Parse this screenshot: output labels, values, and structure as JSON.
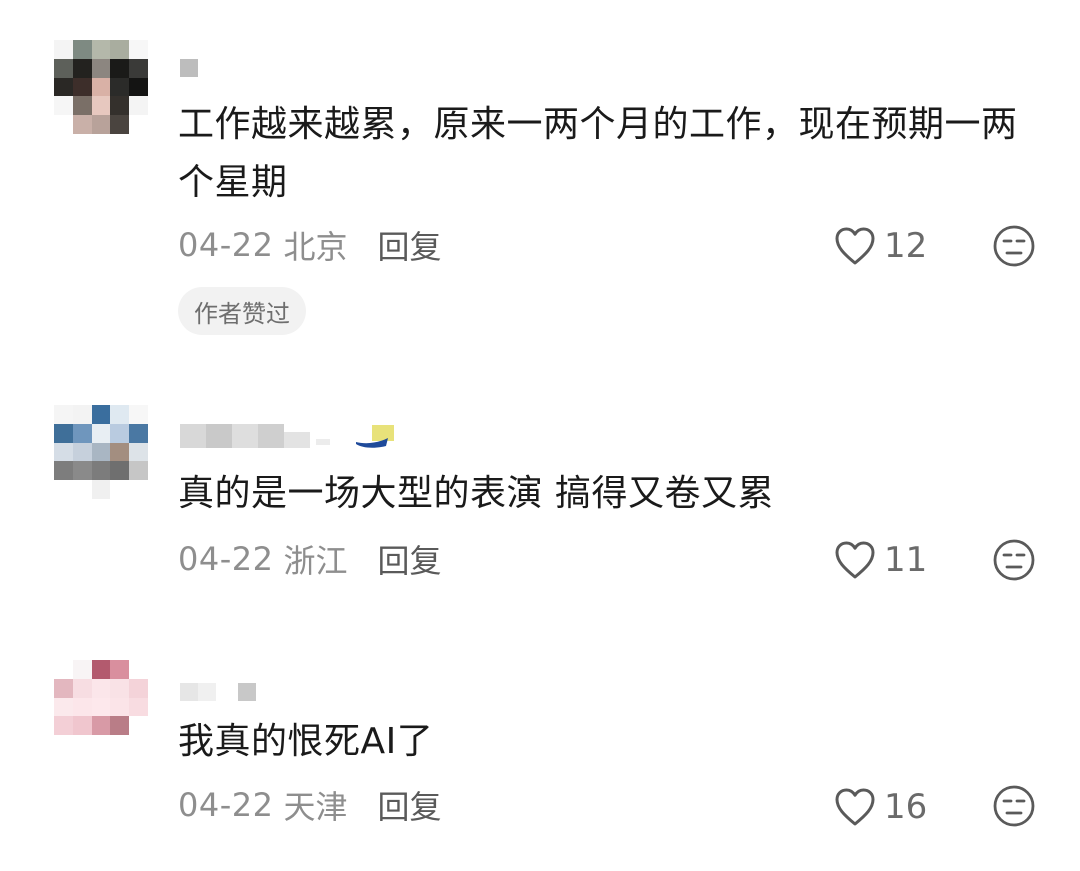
{
  "comments": [
    {
      "text": "工作越来越累，原来一两个月的工作，现在预期一两个星期",
      "date": "04-22",
      "location": "北京",
      "reply_label": "回复",
      "likes": "12",
      "badge": "作者赞过"
    },
    {
      "text": "真的是一场大型的表演 搞得又卷又累",
      "date": "04-22",
      "location": "浙江",
      "reply_label": "回复",
      "likes": "11"
    },
    {
      "text": "我真的恨死AI了",
      "date": "04-22",
      "location": "天津",
      "reply_label": "回复",
      "likes": "16"
    }
  ],
  "icons": {
    "like": "heart-outline-icon",
    "dislike": "neutral-face-icon"
  },
  "colors": {
    "text": "#1a1a1a",
    "meta": "#8e8e8e",
    "reply": "#5a5a5a",
    "badge_bg": "#f2f2f2"
  }
}
